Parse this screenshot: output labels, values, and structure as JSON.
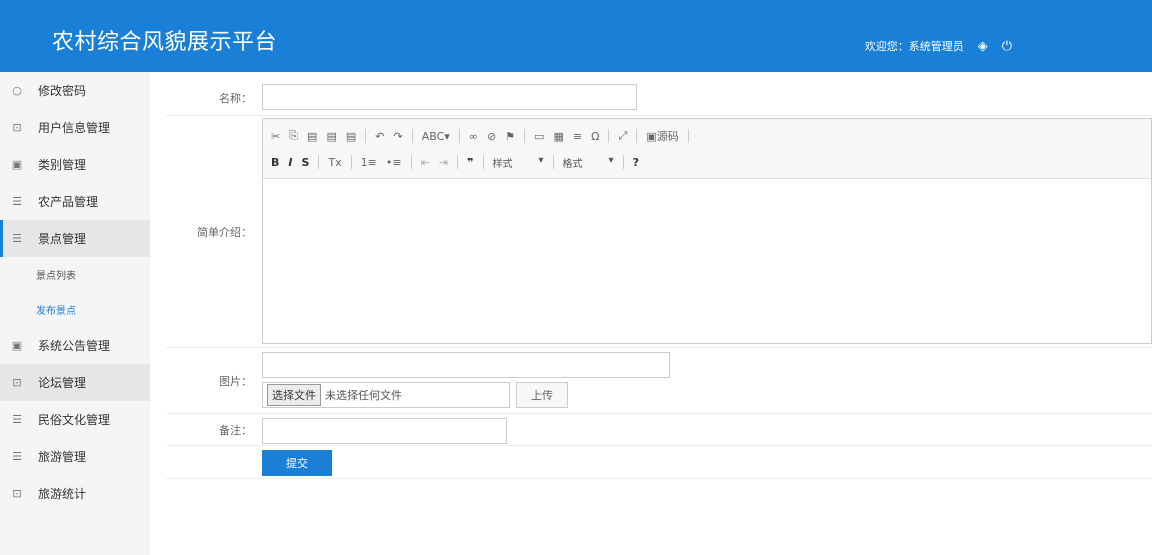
{
  "app": {
    "title": "农村综合风貌展示平台"
  },
  "header": {
    "welcome": "欢迎您：系统管理员",
    "icons": [
      "settings-icon",
      "power-icon"
    ]
  },
  "sidebar": {
    "items": [
      {
        "label": "修改密码",
        "icon": "○"
      },
      {
        "label": "用户信息管理",
        "icon": "⊡"
      },
      {
        "label": "类别管理",
        "icon": "▣"
      },
      {
        "label": "农产品管理",
        "icon": "☰"
      },
      {
        "label": "景点管理",
        "icon": "☰"
      },
      {
        "label": "系统公告管理",
        "icon": "▣"
      },
      {
        "label": "论坛管理",
        "icon": "⊡"
      },
      {
        "label": "民俗文化管理",
        "icon": "☰"
      },
      {
        "label": "旅游管理",
        "icon": "☰"
      },
      {
        "label": "旅游统计",
        "icon": "⊡"
      }
    ],
    "sub_items": [
      {
        "label": "景点列表"
      },
      {
        "label": "发布景点"
      }
    ]
  },
  "form": {
    "name_label": "名称：",
    "intro_label": "简单介绍：",
    "image_label": "图片：",
    "remark_label": "备注：",
    "file_button": "选择文件",
    "file_none": "未选择任何文件",
    "upload_button": "上传",
    "submit_button": "提交"
  },
  "editor": {
    "row1": [
      "✂",
      "⎘",
      "▤",
      "▤",
      "▤",
      "↶",
      "↷",
      "ABC▾",
      "∞",
      "⊘",
      "⚑",
      "▭",
      "▦",
      "≡",
      "Ω",
      "⤢",
      "▣源码"
    ],
    "row2_marks": [
      "B",
      "I",
      "S",
      "Tx",
      "1≡",
      "•≡",
      "⇤",
      "⇥",
      "❞"
    ],
    "style_label": "样式",
    "format_label": "格式",
    "help_label": "?"
  },
  "colors": {
    "primary": "#1a7fd6"
  }
}
